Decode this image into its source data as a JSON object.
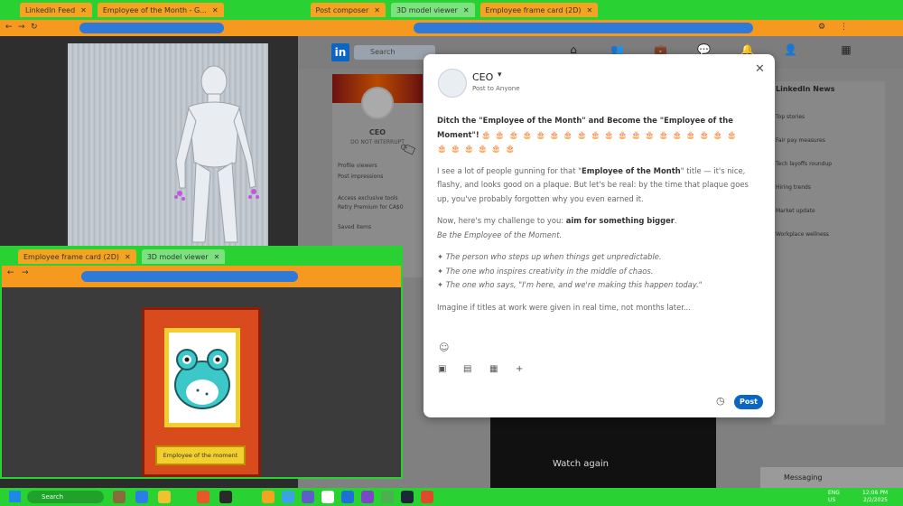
{
  "browser": {
    "tabs": [
      {
        "label": "LinkedIn Feed",
        "style": "orange"
      },
      {
        "label": "Employee of the Month - G...",
        "style": "orange"
      },
      {
        "label": "Post composer",
        "style": "orange"
      },
      {
        "label": "3D model viewer",
        "style": "green"
      },
      {
        "label": "Employee frame card (2D)",
        "style": "orange"
      }
    ]
  },
  "linkedin": {
    "logo": "in",
    "search_placeholder": "Search",
    "profile": {
      "name": "CEO",
      "subtitle": "DO NOT INTERRUPT",
      "lines": [
        "Profile viewers",
        "Post impressions",
        "Access exclusive tools",
        "Retry Premium for CA$0",
        "Saved items"
      ]
    },
    "right_col": {
      "title": "LinkedIn News",
      "items": [
        "Top stories",
        "Fair pay measures",
        "Tech layoffs roundup",
        "Hiring trends",
        "Market update",
        "Workplace wellness"
      ]
    },
    "video": {
      "watch_again": "Watch again"
    },
    "messaging": "Messaging"
  },
  "modal": {
    "author": "CEO",
    "audience": "Post to Anyone",
    "close_icon": "close-icon",
    "headline_1": "Ditch the \"Employee of the Month\" and Become the \"Employee of the Moment\"!",
    "emoji_row": "🎂 🎂 🎂 🎂 🎂 🎂 🎂 🎂 🎂 🎂 🎂 🎂 🎂 🎂 🎂 🎂 🎂 🎂 🎂 🎂 🎂 🎂 🎂 🎂 🎂",
    "para_1a": "I see a lot of people gunning for that \"",
    "para_1b": "Employee of the Month",
    "para_1c": "\" title — it's nice, flashy, and looks good on a plaque. But let's be real: by the time that plaque goes up, you've probably forgotten why you even earned it.",
    "para_2a": "Now, here's my challenge to you: ",
    "para_2b": "aim for something bigger",
    "para_2c": ".",
    "para_2d": "Be the Employee of the Moment.",
    "bullets": [
      "The person who steps up when things get unpredictable.",
      "The one who inspires creativity in the middle of chaos.",
      "The one who says, \"I'm here, and we're making this happen today.\""
    ],
    "cut_line": "Imagine if titles at work were given in real time, not months later...",
    "post_label": "Post"
  },
  "card": {
    "label": "Employee of the moment"
  },
  "taskbar": {
    "search": "Search",
    "lang": "ENG\nUS",
    "time": "12:06 PM",
    "date": "2/2/2025"
  },
  "colors": {
    "accent_green": "#29d232",
    "accent_orange": "#f59a1e",
    "linkedin_blue": "#0a66c2"
  }
}
